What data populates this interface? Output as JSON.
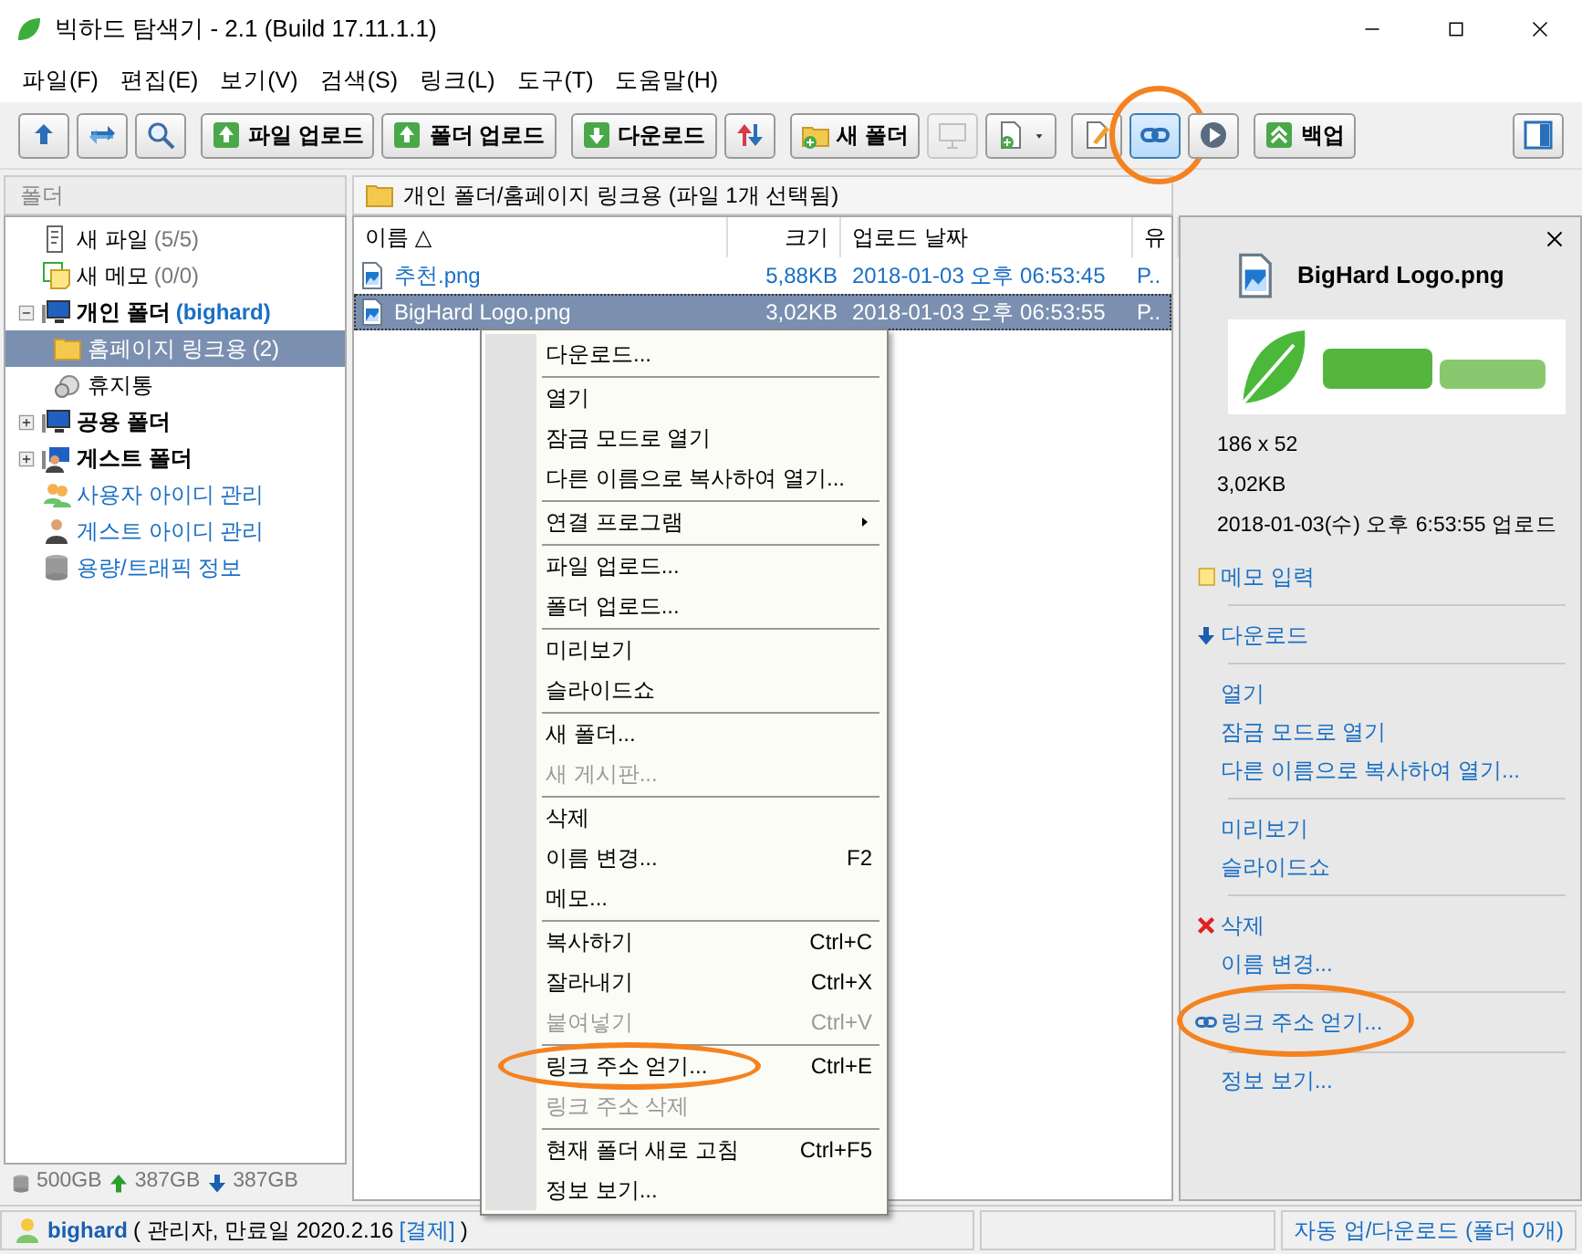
{
  "window": {
    "title": "빅하드 탐색기 - 2.1 (Build 17.11.1.1)"
  },
  "menu": [
    "파일(F)",
    "편집(E)",
    "보기(V)",
    "검색(S)",
    "링크(L)",
    "도구(T)",
    "도움말(H)"
  ],
  "toolbar": [
    [
      {
        "kind": "icon",
        "disabled": false,
        "highlighted": false
      },
      {
        "kind": "icon",
        "disabled": false,
        "highlighted": false
      },
      {
        "kind": "icon",
        "disabled": false,
        "highlighted": false
      }
    ],
    [
      {
        "kind": "text",
        "label": "파일 업로드",
        "disabled": false,
        "highlighted": false
      },
      {
        "kind": "text",
        "label": "폴더 업로드",
        "disabled": false,
        "highlighted": false
      }
    ],
    [
      {
        "kind": "text",
        "label": "다운로드",
        "disabled": false,
        "highlighted": false
      },
      {
        "kind": "icon",
        "disabled": false,
        "highlighted": false
      }
    ],
    [
      {
        "kind": "text",
        "label": "새 폴더",
        "disabled": false,
        "highlighted": false
      },
      {
        "kind": "icon",
        "disabled": true,
        "highlighted": false
      },
      {
        "kind": "dropdown",
        "disabled": false,
        "highlighted": false
      }
    ],
    [
      {
        "kind": "icon",
        "disabled": false,
        "highlighted": false
      },
      {
        "kind": "icon",
        "disabled": false,
        "highlighted": true
      },
      {
        "kind": "icon",
        "disabled": false,
        "highlighted": false
      }
    ],
    [
      {
        "kind": "text",
        "label": "백업",
        "disabled": false,
        "highlighted": false
      }
    ],
    [
      {
        "kind": "icon",
        "disabled": false,
        "highlighted": false
      }
    ]
  ],
  "sidebar": {
    "header": "폴더",
    "items": [
      {
        "kind": "newfile",
        "label": "새 파일",
        "count": "(5/5)",
        "selected": false
      },
      {
        "kind": "memo",
        "label": "새 메모",
        "count": "(0/0)",
        "selected": false
      },
      {
        "kind": "folder",
        "label": "개인 폴더",
        "owner": "(bighard)",
        "expanded": true,
        "selected": false,
        "children": [
          {
            "kind": "subfolder",
            "label": "홈페이지 링크용",
            "count": "(2)",
            "selected": true
          },
          {
            "kind": "trash",
            "label": "휴지통",
            "selected": false
          }
        ]
      },
      {
        "kind": "folder",
        "label": "공용 폴더",
        "expanded": false,
        "selected": false
      },
      {
        "kind": "guestfolder",
        "label": "게스트 폴더",
        "expanded": false,
        "selected": false
      },
      {
        "kind": "users",
        "label": "사용자 아이디 관리",
        "selected": false
      },
      {
        "kind": "guest",
        "label": "게스트 아이디 관리",
        "selected": false
      },
      {
        "kind": "storage",
        "label": "용량/트래픽 정보",
        "selected": false
      }
    ],
    "storage": {
      "total": "500GB",
      "upload": "387GB",
      "download": "387GB"
    }
  },
  "path": "개인 폴더/홈페이지 링크용 (파일 1개 선택됨)",
  "table": {
    "columns": [
      "이름 △",
      "크기",
      "업로드 날짜",
      "유"
    ],
    "rows": [
      {
        "name": "추천.png",
        "size": "5,88KB",
        "date": "2018-01-03 오후 06:53:45",
        "column_4": "P..",
        "selected": false
      },
      {
        "name": "BigHard Logo.png",
        "size": "3,02KB",
        "date": "2018-01-03 오후 06:53:55",
        "column_4": "P..",
        "selected": true
      }
    ]
  },
  "context_menu": [
    {
      "kind": "item",
      "label": "다운로드...",
      "disabled": false,
      "highlighted": false
    },
    {
      "kind": "separator"
    },
    {
      "kind": "item",
      "label": "열기",
      "disabled": false,
      "highlighted": false
    },
    {
      "kind": "item",
      "label": "잠금 모드로 열기",
      "disabled": false,
      "highlighted": false
    },
    {
      "kind": "item",
      "label": "다른 이름으로 복사하여 열기...",
      "disabled": false,
      "highlighted": false
    },
    {
      "kind": "separator"
    },
    {
      "kind": "submenu",
      "label": "연결 프로그램",
      "disabled": false,
      "highlighted": false
    },
    {
      "kind": "separator"
    },
    {
      "kind": "item",
      "label": "파일 업로드...",
      "disabled": false,
      "highlighted": false
    },
    {
      "kind": "item",
      "label": "폴더 업로드...",
      "disabled": false,
      "highlighted": false
    },
    {
      "kind": "separator"
    },
    {
      "kind": "item",
      "label": "미리보기",
      "disabled": false,
      "highlighted": false
    },
    {
      "kind": "item",
      "label": "슬라이드쇼",
      "disabled": false,
      "highlighted": false
    },
    {
      "kind": "separator"
    },
    {
      "kind": "item",
      "label": "새 폴더...",
      "disabled": false,
      "highlighted": false
    },
    {
      "kind": "item",
      "label": "새 게시판...",
      "disabled": true,
      "highlighted": false
    },
    {
      "kind": "separator"
    },
    {
      "kind": "item",
      "label": "삭제",
      "disabled": false,
      "highlighted": false
    },
    {
      "kind": "item",
      "label": "이름 변경...",
      "shortcut": "F2",
      "disabled": false,
      "highlighted": false
    },
    {
      "kind": "item",
      "label": "메모...",
      "disabled": false,
      "highlighted": false
    },
    {
      "kind": "separator"
    },
    {
      "kind": "item",
      "label": "복사하기",
      "shortcut": "Ctrl+C",
      "disabled": false,
      "highlighted": false
    },
    {
      "kind": "item",
      "label": "잘라내기",
      "shortcut": "Ctrl+X",
      "disabled": false,
      "highlighted": false
    },
    {
      "kind": "item",
      "label": "붙여넣기",
      "shortcut": "Ctrl+V",
      "disabled": true,
      "highlighted": false
    },
    {
      "kind": "separator"
    },
    {
      "kind": "item",
      "label": "링크 주소 얻기...",
      "shortcut": "Ctrl+E",
      "disabled": false,
      "highlighted": true
    },
    {
      "kind": "item",
      "label": "링크 주소 삭제",
      "disabled": true,
      "highlighted": false
    },
    {
      "kind": "separator"
    },
    {
      "kind": "item",
      "label": "현재 폴더 새로 고침",
      "shortcut": "Ctrl+F5",
      "disabled": false,
      "highlighted": false
    },
    {
      "kind": "item",
      "label": "정보 보기...",
      "disabled": false,
      "highlighted": false
    }
  ],
  "details": {
    "filename": "BigHard Logo.png",
    "preview": {
      "kind": "picture"
    },
    "info": [
      "186 x 52",
      "3,02KB",
      "2018-01-03(수) 오후 6:53:55 업로드"
    ],
    "actions": [
      {
        "kind": "memo",
        "label": "메모 입력",
        "highlighted": false
      },
      {
        "kind": "separator"
      },
      {
        "kind": "download",
        "label": "다운로드",
        "highlighted": false
      },
      {
        "kind": "separator"
      },
      {
        "kind": "plain",
        "label": "열기",
        "highlighted": false
      },
      {
        "kind": "plain",
        "label": "잠금 모드로 열기",
        "highlighted": false
      },
      {
        "kind": "plain",
        "label": "다른 이름으로 복사하여 열기...",
        "highlighted": false
      },
      {
        "kind": "separator"
      },
      {
        "kind": "plain",
        "label": "미리보기",
        "highlighted": false
      },
      {
        "kind": "plain",
        "label": "슬라이드쇼",
        "highlighted": false
      },
      {
        "kind": "separator"
      },
      {
        "kind": "delete",
        "label": "삭제",
        "highlighted": false
      },
      {
        "kind": "plain",
        "label": "이름 변경...",
        "highlighted": false
      },
      {
        "kind": "separator"
      },
      {
        "kind": "link",
        "label": "링크 주소 얻기...",
        "highlighted": true
      },
      {
        "kind": "separator"
      },
      {
        "kind": "plain",
        "label": "정보 보기...",
        "highlighted": false
      }
    ]
  },
  "status_bar": {
    "user": "bighard",
    "role": "( 관리자, 만료일 2020.2.16",
    "pay_link": "[결제]",
    "close": ")",
    "transfer": "자동 업/다운로드 (폴더 0개)"
  }
}
